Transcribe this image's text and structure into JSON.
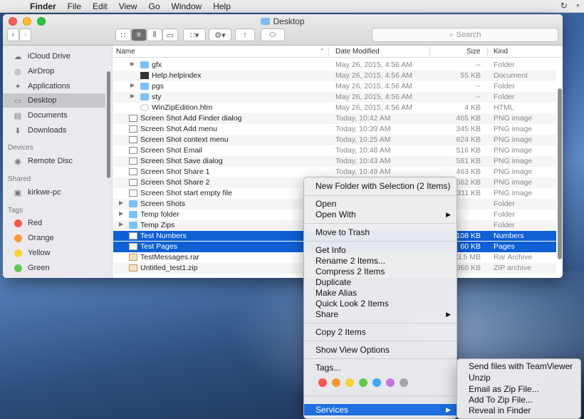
{
  "menubar": {
    "app": "Finder",
    "items": [
      "File",
      "Edit",
      "View",
      "Go",
      "Window",
      "Help"
    ]
  },
  "window": {
    "title": "Desktop",
    "search_placeholder": "Search"
  },
  "sidebar": {
    "favorites": [
      "iCloud Drive",
      "AirDrop",
      "Applications",
      "Desktop",
      "Documents",
      "Downloads"
    ],
    "devices_heading": "Devices",
    "devices": [
      "Remote Disc"
    ],
    "shared_heading": "Shared",
    "shared": [
      "kirkwe-pc"
    ],
    "tags_heading": "Tags",
    "tags": [
      {
        "label": "Red",
        "color": "#f2564c"
      },
      {
        "label": "Orange",
        "color": "#f79a35"
      },
      {
        "label": "Yellow",
        "color": "#f6d234"
      },
      {
        "label": "Green",
        "color": "#5fc94e"
      }
    ]
  },
  "columns": {
    "name": "Name",
    "date": "Date Modified",
    "size": "Size",
    "kind": "Kind"
  },
  "files": [
    {
      "name": "gfx",
      "date": "May 26, 2015, 4:56 AM",
      "size": "--",
      "kind": "Folder"
    },
    {
      "name": "Help.helpindex",
      "date": "May 26, 2015, 4:56 AM",
      "size": "55 KB",
      "kind": "Document"
    },
    {
      "name": "pgs",
      "date": "May 26, 2015, 4:56 AM",
      "size": "--",
      "kind": "Folder"
    },
    {
      "name": "sty",
      "date": "May 26, 2015, 4:56 AM",
      "size": "--",
      "kind": "Folder"
    },
    {
      "name": "WinZipEdition.htm",
      "date": "May 26, 2015, 4:56 AM",
      "size": "4 KB",
      "kind": "HTML"
    },
    {
      "name": "Screen Shot Add Finder dialog",
      "date": "Today, 10:42 AM",
      "size": "465 KB",
      "kind": "PNG image"
    },
    {
      "name": "Screen Shot Add menu",
      "date": "Today, 10:39 AM",
      "size": "345 KB",
      "kind": "PNG image"
    },
    {
      "name": "Screen Shot context menu",
      "date": "Today, 10:25 AM",
      "size": "624 KB",
      "kind": "PNG image"
    },
    {
      "name": "Screen Shot Email",
      "date": "Today, 10:48 AM",
      "size": "516 KB",
      "kind": "PNG image"
    },
    {
      "name": "Screen Shot Save dialog",
      "date": "Today, 10:43 AM",
      "size": "581 KB",
      "kind": "PNG image"
    },
    {
      "name": "Screen Shot Share 1",
      "date": "Today, 10:49 AM",
      "size": "463 KB",
      "kind": "PNG image"
    },
    {
      "name": "Screen Shot Share 2",
      "date": "",
      "size": "562 KB",
      "kind": "PNG image"
    },
    {
      "name": "Screen Shot start empty file",
      "date": "",
      "size": "311 KB",
      "kind": "PNG image"
    },
    {
      "name": "Screen Shots",
      "date": "",
      "size": "--",
      "kind": "Folder"
    },
    {
      "name": "Temp folder",
      "date": "",
      "size": "--",
      "kind": "Folder"
    },
    {
      "name": "Temp Zips",
      "date": "",
      "size": "--",
      "kind": "Folder"
    },
    {
      "name": "Test Numbers",
      "date": "",
      "size": "108 KB",
      "kind": "Numbers"
    },
    {
      "name": "Test Pages",
      "date": "",
      "size": "60 KB",
      "kind": "Pages"
    },
    {
      "name": "TestMessages.rar",
      "date": "",
      "size": "3.5 MB",
      "kind": "Rar Archive"
    },
    {
      "name": "Untitled_test1.zip",
      "date": "",
      "size": "960 KB",
      "kind": "ZIP archive"
    }
  ],
  "context_menu": {
    "new_folder": "New Folder with Selection (2 Items)",
    "open": "Open",
    "open_with": "Open With",
    "move_to_trash": "Move to Trash",
    "get_info": "Get Info",
    "rename": "Rename 2 Items...",
    "compress": "Compress 2 Items",
    "duplicate": "Duplicate",
    "make_alias": "Make Alias",
    "quick_look": "Quick Look 2 Items",
    "share": "Share",
    "copy": "Copy 2 Items",
    "show_view_options": "Show View Options",
    "tags": "Tags...",
    "tag_colors": [
      "#f2564c",
      "#f79a35",
      "#f6d234",
      "#5fc94e",
      "#3fa8f0",
      "#c774e0",
      "#a5a5a5"
    ],
    "services": "Services"
  },
  "services_menu": [
    "Send files with TeamViewer",
    "Unzip",
    "Email as Zip File...",
    "Add To Zip File...",
    "Reveal in Finder"
  ]
}
